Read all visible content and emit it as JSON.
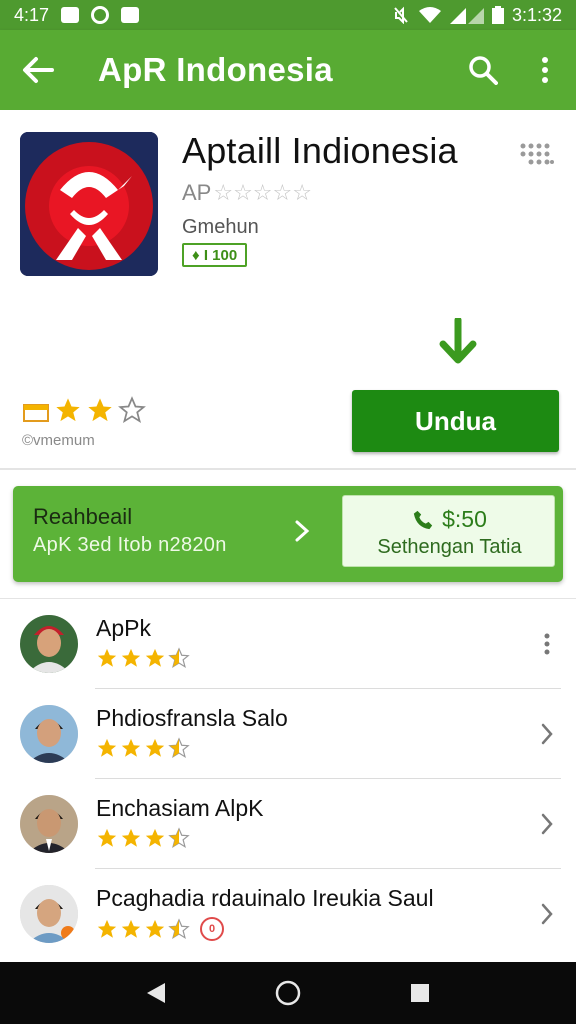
{
  "status_bar": {
    "time": "4:17",
    "clock_right": "3:1:32",
    "icons": [
      "photo-icon",
      "circle-icon",
      "notification-icon",
      "mute-icon",
      "wifi-icon",
      "signal-icon",
      "battery-icon"
    ]
  },
  "app_bar": {
    "title": "ApR Indonesia",
    "back_icon": "back-arrow-icon",
    "search_icon": "search-icon",
    "menu_icon": "more-vert-icon"
  },
  "header": {
    "app_name": "Aptaill Indionesia",
    "developer_prefix": "AP",
    "developer_rating": 0,
    "category": "Gmehun",
    "badge": "♦ I 100",
    "rating_stars": 3,
    "rating_max": 4,
    "rating_label": "©vmemum",
    "install_label": "Undua"
  },
  "promo": {
    "title": "Reahbeail",
    "subtitle": "ApK 3ed Itob n2820n",
    "offer_price": "$:50",
    "offer_label": "Sethengan Tatia"
  },
  "list": {
    "items": [
      {
        "title": "ApPk",
        "rating": 3.5,
        "trailing": "more"
      },
      {
        "title": "Phdiosfransla Salo",
        "rating": 3.5,
        "trailing": "chevron"
      },
      {
        "title": "Enchasiam AlpK",
        "rating": 3.5,
        "trailing": "chevron"
      },
      {
        "title": "Pcaghadia rdauinalo Ireukia Saul",
        "rating": 3.5,
        "trailing": "chevron",
        "badge": "0"
      }
    ]
  },
  "colors": {
    "app_bar": "#58ab33",
    "status_bar": "#4e9a2f",
    "install_button": "#1d8a12",
    "promo": "#5cb338",
    "star": "#f4b400"
  }
}
